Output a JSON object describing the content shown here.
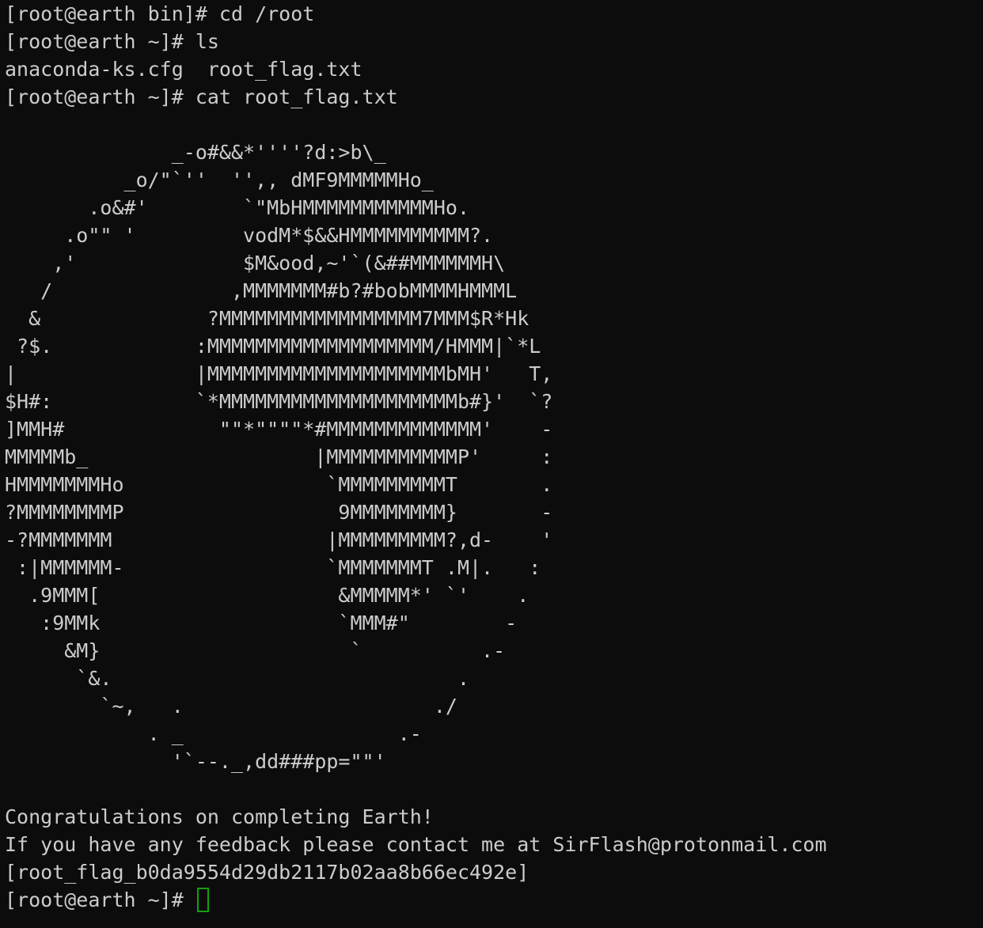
{
  "terminal": {
    "commands": [
      "[root@earth bin]# cd /root",
      "[root@earth ~]# ls",
      "anaconda-ks.cfg  root_flag.txt",
      "[root@earth ~]# cat root_flag.txt"
    ],
    "art": [
      "              _-o#&&*''''?d:>b\\_",
      "          _o/\"`''  '',, dMF9MMMMMHo_",
      "       .o&#'        `\"MbHMMMMMMMMMMMHo.",
      "     .o\"\" '         vodM*$&&HMMMMMMMMMM?.",
      "    ,'              $M&ood,~'`(&##MMMMMMH\\",
      "   /               ,MMMMMMM#b?#bobMMMMHMMML",
      "  &              ?MMMMMMMMMMMMMMMMM7MMM$R*Hk",
      " ?$.            :MMMMMMMMMMMMMMMMMMM/HMMM|`*L",
      "|               |MMMMMMMMMMMMMMMMMMMMbMH'   T,",
      "$H#:            `*MMMMMMMMMMMMMMMMMMMMb#}'  `?",
      "]MMH#             \"\"*\"\"\"\"*#MMMMMMMMMMMMM'    -",
      "MMMMMb_                   |MMMMMMMMMMMP'     :",
      "HMMMMMMMHo                 `MMMMMMMMMT       .",
      "?MMMMMMMMP                  9MMMMMMMM}       -",
      "-?MMMMMMM                  |MMMMMMMMM?,d-    '",
      " :|MMMMMM-                 `MMMMMMMT .M|.   :",
      "  .9MMM[                    &MMMMM*' `'    .",
      "   :9MMk                    `MMM#\"        -",
      "     &M}                     `          .-",
      "      `&.                             .",
      "        `~,   .                     ./",
      "            . _                  .-",
      "              '`--._,dd###pp=\"\"'"
    ],
    "messages": [
      "Congratulations on completing Earth!",
      "If you have any feedback please contact me at SirFlash@protonmail.com",
      "[root_flag_b0da9554d29db2117b02aa8b66ec492e]"
    ],
    "prompt": "[root@earth ~]# ",
    "colors": {
      "background": "#0c0c0c",
      "foreground": "#cccccc",
      "cursor": "#13a10e"
    }
  }
}
